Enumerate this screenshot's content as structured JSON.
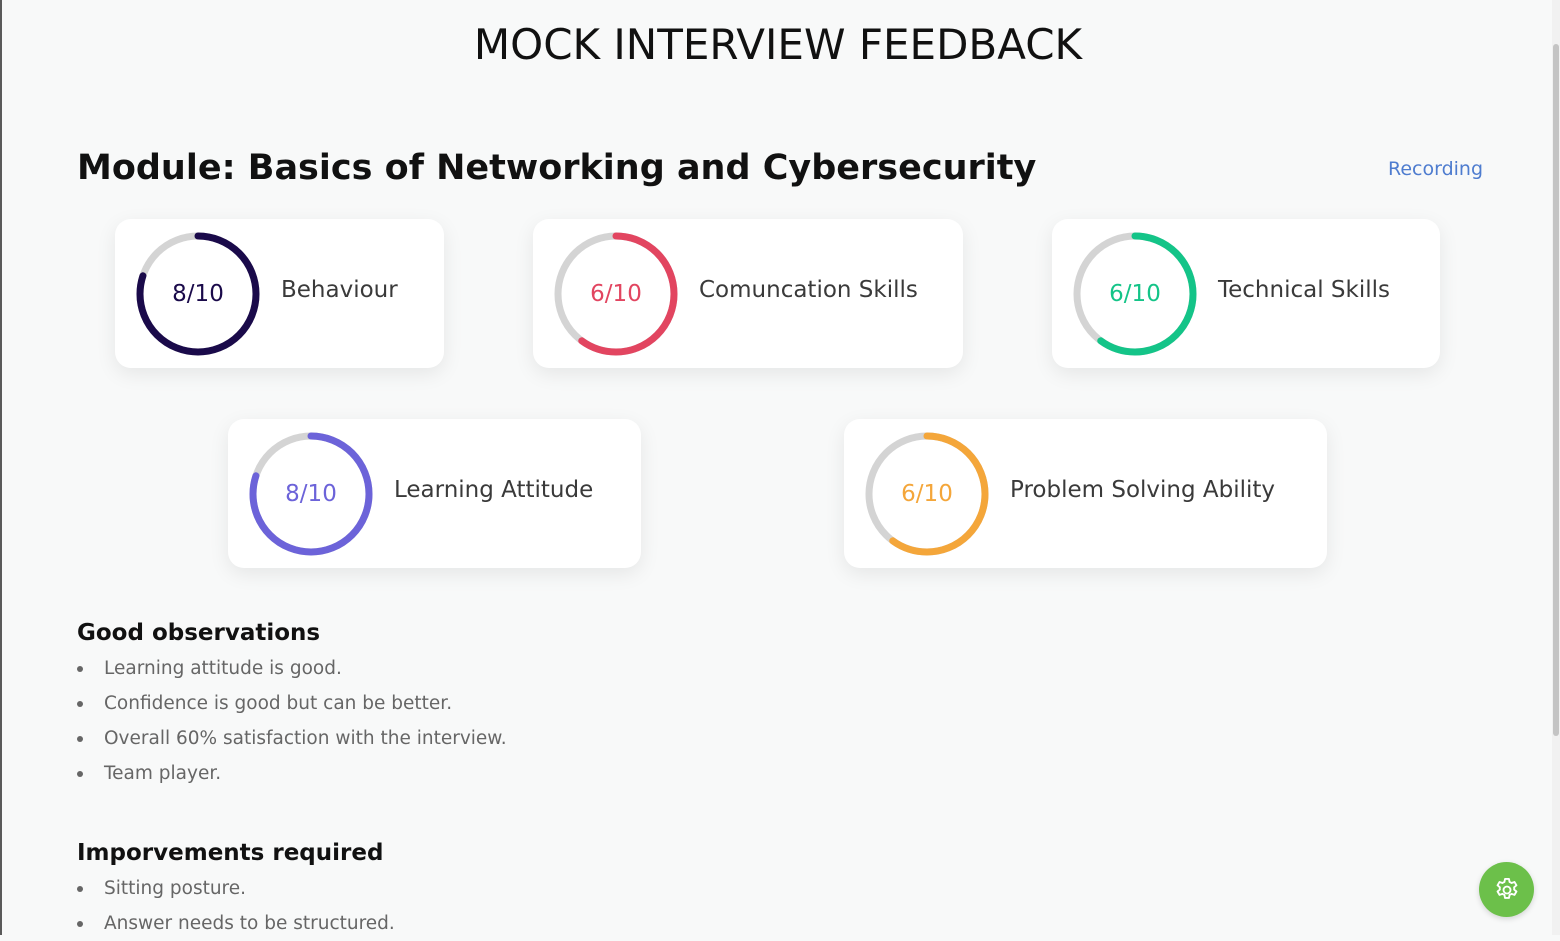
{
  "page": {
    "title": "MOCK INTERVIEW FEEDBACK",
    "module_title": "Module: Basics of Networking and Cybersecurity",
    "recording_label": "Recording"
  },
  "scores": [
    {
      "label": "Behaviour",
      "score_text": "8/10",
      "score": 8,
      "max": 10,
      "color": "#1a0a4a"
    },
    {
      "label": "Comuncation Skills",
      "score_text": "6/10",
      "score": 6,
      "max": 10,
      "color": "#e24560"
    },
    {
      "label": "Technical Skills",
      "score_text": "6/10",
      "score": 6,
      "max": 10,
      "color": "#14c488"
    },
    {
      "label": "Learning Attitude",
      "score_text": "8/10",
      "score": 8,
      "max": 10,
      "color": "#6c63d9"
    },
    {
      "label": "Problem Solving Ability",
      "score_text": "6/10",
      "score": 6,
      "max": 10,
      "color": "#f4a63a"
    }
  ],
  "good_observations": {
    "heading": "Good observations",
    "items": [
      "Learning attitude is good.",
      "Confidence is good but can be better.",
      "Overall 60% satisfaction with the interview.",
      "Team player."
    ]
  },
  "improvements": {
    "heading": "Imporvements required",
    "items": [
      "Sitting posture.",
      "Answer needs to be structured."
    ]
  },
  "fab": {
    "icon": "gear-icon",
    "color": "#6cc04a"
  },
  "track_color": "#d4d4d4"
}
